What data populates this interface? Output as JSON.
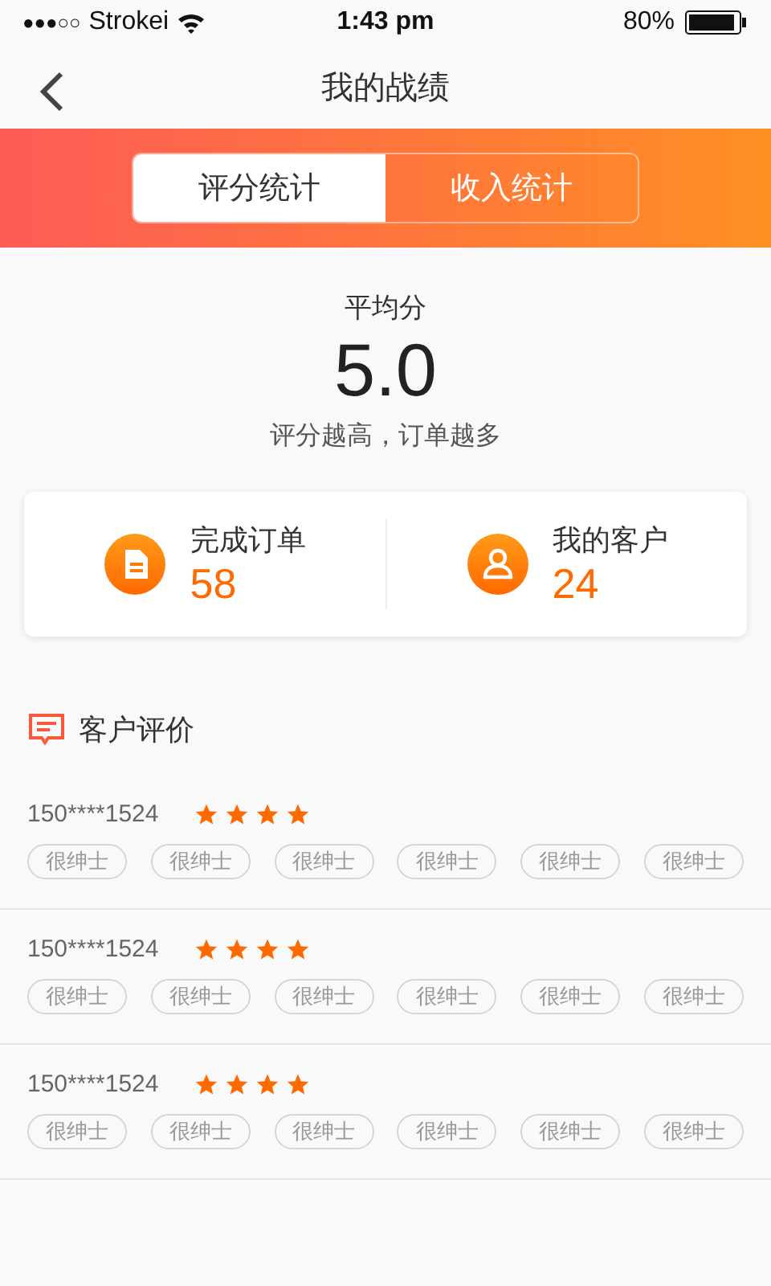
{
  "status_bar": {
    "signal": "●●●○○",
    "carrier": "Strokei",
    "time": "1:43 pm",
    "battery": "80%"
  },
  "nav": {
    "title": "我的战绩"
  },
  "tabs": [
    {
      "label": "评分统计",
      "selected": true
    },
    {
      "label": "收入统计",
      "selected": false
    }
  ],
  "score": {
    "label": "平均分",
    "value": "5.0",
    "hint": "评分越高，订单越多"
  },
  "stats": [
    {
      "kind": "orders",
      "label": "完成订单",
      "value": "58"
    },
    {
      "kind": "customers",
      "label": "我的客户",
      "value": "24"
    }
  ],
  "reviews_title": "客户评价",
  "reviews": [
    {
      "phone": "150****1524",
      "stars": 4,
      "tags": [
        "很绅士",
        "很绅士",
        "很绅士",
        "很绅士",
        "很绅士",
        "很绅士"
      ]
    },
    {
      "phone": "150****1524",
      "stars": 4,
      "tags": [
        "很绅士",
        "很绅士",
        "很绅士",
        "很绅士",
        "很绅士",
        "很绅士"
      ]
    },
    {
      "phone": "150****1524",
      "stars": 4,
      "tags": [
        "很绅士",
        "很绅士",
        "很绅士",
        "很绅士",
        "很绅士",
        "很绅士"
      ]
    }
  ]
}
